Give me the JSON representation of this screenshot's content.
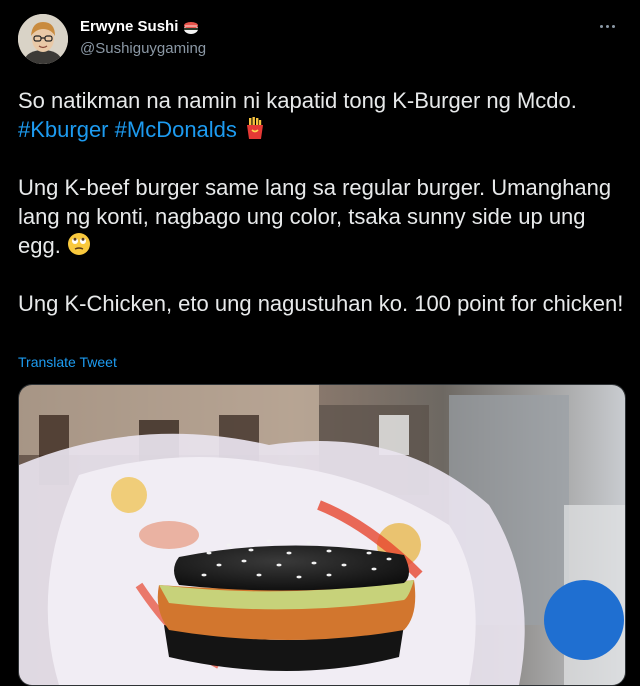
{
  "author": {
    "display_name": "Erwyne Sushi",
    "handle": "@Sushiguygaming",
    "badge_icon": "sushi-emoji-icon"
  },
  "tweet": {
    "line1": "So natikman na namin ni kapatid tong K-Burger ng Mcdo.",
    "hashtag1": "#Kburger",
    "hashtag2": "#McDonalds",
    "fries_icon": "french-fries-emoji-icon",
    "para2": "Ung K-beef burger same lang sa regular burger. Umanghang lang ng konti, nagbago ung color, tsaka sunny side up ung egg.",
    "face_icon": "face-with-rolling-eyes-emoji-icon",
    "para3": "Ung K-Chicken, eto ung nagustuhan ko. 100 point for chicken!"
  },
  "translate_label": "Translate Tweet",
  "media": {
    "subject": "photo of K-Chicken burger with black sesame buns in wrapper"
  },
  "colors": {
    "background": "#000000",
    "link": "#1d9bf0",
    "text": "#e7e9ea",
    "muted": "#8b98a5"
  }
}
